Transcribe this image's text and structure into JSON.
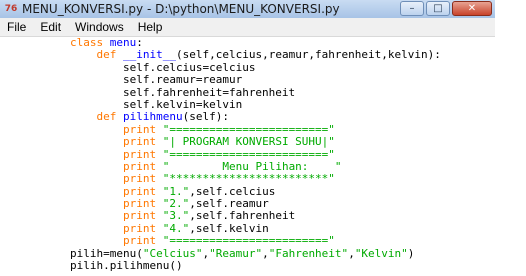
{
  "window": {
    "title": "MENU_KONVERSI.py - D:\\python\\MENU_KONVERSI.py",
    "app_icon": "76",
    "minimize": "–",
    "maximize": "□",
    "close": "✕"
  },
  "menubar": {
    "items": [
      "File",
      "Edit",
      "Windows",
      "Help"
    ]
  },
  "code_lines": [
    {
      "indent": "",
      "tokens": [
        {
          "c": "kw",
          "t": "class"
        },
        {
          "c": "pl",
          "t": " "
        },
        {
          "c": "def",
          "t": "menu"
        },
        {
          "c": "pl",
          "t": ":"
        }
      ]
    },
    {
      "indent": "    ",
      "tokens": [
        {
          "c": "kw",
          "t": "def"
        },
        {
          "c": "pl",
          "t": " "
        },
        {
          "c": "def",
          "t": "__init__"
        },
        {
          "c": "pl",
          "t": "(self,celcius,reamur,fahrenheit,kelvin):"
        }
      ]
    },
    {
      "indent": "        ",
      "tokens": [
        {
          "c": "pl",
          "t": "self.celcius=celcius"
        }
      ]
    },
    {
      "indent": "        ",
      "tokens": [
        {
          "c": "pl",
          "t": "self.reamur=reamur"
        }
      ]
    },
    {
      "indent": "        ",
      "tokens": [
        {
          "c": "pl",
          "t": "self.fahrenheit=fahrenheit"
        }
      ]
    },
    {
      "indent": "        ",
      "tokens": [
        {
          "c": "pl",
          "t": "self.kelvin=kelvin"
        }
      ]
    },
    {
      "indent": "    ",
      "tokens": [
        {
          "c": "kw",
          "t": "def"
        },
        {
          "c": "pl",
          "t": " "
        },
        {
          "c": "def",
          "t": "pilihmenu"
        },
        {
          "c": "pl",
          "t": "(self):"
        }
      ]
    },
    {
      "indent": "        ",
      "tokens": [
        {
          "c": "kw",
          "t": "print"
        },
        {
          "c": "pl",
          "t": " "
        },
        {
          "c": "str",
          "t": "\"========================\""
        }
      ]
    },
    {
      "indent": "        ",
      "tokens": [
        {
          "c": "kw",
          "t": "print"
        },
        {
          "c": "pl",
          "t": " "
        },
        {
          "c": "str",
          "t": "\"| PROGRAM KONVERSI SUHU|\""
        }
      ]
    },
    {
      "indent": "        ",
      "tokens": [
        {
          "c": "kw",
          "t": "print"
        },
        {
          "c": "pl",
          "t": " "
        },
        {
          "c": "str",
          "t": "\"========================\""
        }
      ]
    },
    {
      "indent": "        ",
      "tokens": [
        {
          "c": "kw",
          "t": "print"
        },
        {
          "c": "pl",
          "t": " "
        },
        {
          "c": "str",
          "t": "\"        Menu Pilihan:    \""
        }
      ]
    },
    {
      "indent": "        ",
      "tokens": [
        {
          "c": "kw",
          "t": "print"
        },
        {
          "c": "pl",
          "t": " "
        },
        {
          "c": "str",
          "t": "\"************************\""
        }
      ]
    },
    {
      "indent": "        ",
      "tokens": [
        {
          "c": "kw",
          "t": "print"
        },
        {
          "c": "pl",
          "t": " "
        },
        {
          "c": "str",
          "t": "\"1.\""
        },
        {
          "c": "pl",
          "t": ",self.celcius"
        }
      ]
    },
    {
      "indent": "        ",
      "tokens": [
        {
          "c": "kw",
          "t": "print"
        },
        {
          "c": "pl",
          "t": " "
        },
        {
          "c": "str",
          "t": "\"2.\""
        },
        {
          "c": "pl",
          "t": ",self.reamur"
        }
      ]
    },
    {
      "indent": "        ",
      "tokens": [
        {
          "c": "kw",
          "t": "print"
        },
        {
          "c": "pl",
          "t": " "
        },
        {
          "c": "str",
          "t": "\"3.\""
        },
        {
          "c": "pl",
          "t": ",self.fahrenheit"
        }
      ]
    },
    {
      "indent": "        ",
      "tokens": [
        {
          "c": "kw",
          "t": "print"
        },
        {
          "c": "pl",
          "t": " "
        },
        {
          "c": "str",
          "t": "\"4.\""
        },
        {
          "c": "pl",
          "t": ",self.kelvin"
        }
      ]
    },
    {
      "indent": "        ",
      "tokens": [
        {
          "c": "kw",
          "t": "print"
        },
        {
          "c": "pl",
          "t": " "
        },
        {
          "c": "str",
          "t": "\"========================\""
        }
      ]
    },
    {
      "indent": "",
      "tokens": [
        {
          "c": "pl",
          "t": "pilih=menu("
        },
        {
          "c": "str",
          "t": "\"Celcius\""
        },
        {
          "c": "pl",
          "t": ","
        },
        {
          "c": "str",
          "t": "\"Reamur\""
        },
        {
          "c": "pl",
          "t": ","
        },
        {
          "c": "str",
          "t": "\"Fahrenheit\""
        },
        {
          "c": "pl",
          "t": ","
        },
        {
          "c": "str",
          "t": "\"Kelvin\""
        },
        {
          "c": "pl",
          "t": ")"
        }
      ]
    },
    {
      "indent": "",
      "tokens": [
        {
          "c": "pl",
          "t": "pilih.pilihmenu()"
        }
      ]
    }
  ],
  "colors": {
    "keyword": "#ff7700",
    "definition": "#0000ff",
    "string": "#00aa00",
    "plain": "#000000"
  }
}
